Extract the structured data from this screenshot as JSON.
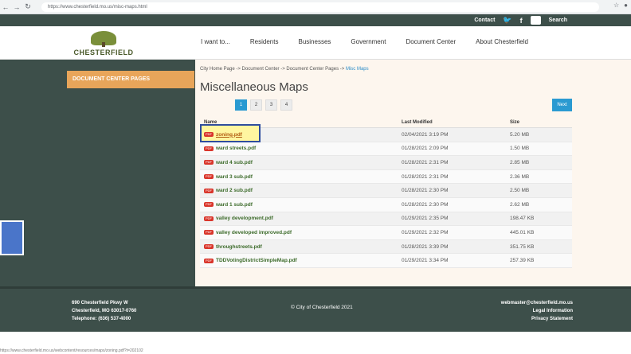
{
  "browser": {
    "url": "https://www.chesterfield.mo.us/misc-maps.html",
    "status_url": "https://www.chesterfield.mo.us/webcontent/resources/maps/zoning.pdf?t=202102"
  },
  "topbar": {
    "contact": "Contact",
    "search": "Search"
  },
  "logo": {
    "text": "CHESTERFIELD"
  },
  "nav": [
    "I want to...",
    "Residents",
    "Businesses",
    "Government",
    "Document Center",
    "About Chesterfield"
  ],
  "sidebar": {
    "title": "DOCUMENT CENTER PAGES"
  },
  "breadcrumb": {
    "items": [
      "City Home Page",
      "Document Center",
      "Document Center Pages"
    ],
    "sep": " -> ",
    "current": "Misc Maps"
  },
  "page_title": "Miscellaneous Maps",
  "pager": {
    "pages": [
      "1",
      "2",
      "3",
      "4"
    ],
    "next": "Next"
  },
  "table": {
    "headers": {
      "name": "Name",
      "modified": "Last Modified",
      "size": "Size"
    },
    "rows": [
      {
        "name": "zoning.pdf",
        "modified": "02/04/2021 3:19 PM",
        "size": "5.20 MB"
      },
      {
        "name": "ward streets.pdf",
        "modified": "01/28/2021 2:09 PM",
        "size": "1.50 MB"
      },
      {
        "name": "ward 4 sub.pdf",
        "modified": "01/28/2021 2:31 PM",
        "size": "2.85 MB"
      },
      {
        "name": "ward 3 sub.pdf",
        "modified": "01/28/2021 2:31 PM",
        "size": "2.36 MB"
      },
      {
        "name": "ward 2 sub.pdf",
        "modified": "01/28/2021 2:30 PM",
        "size": "2.50 MB"
      },
      {
        "name": "ward 1 sub.pdf",
        "modified": "01/28/2021 2:30 PM",
        "size": "2.62 MB"
      },
      {
        "name": "valley development.pdf",
        "modified": "01/29/2021 2:35 PM",
        "size": "198.47 KB"
      },
      {
        "name": "valley developed improved.pdf",
        "modified": "01/29/2021 2:32 PM",
        "size": "445.01 KB"
      },
      {
        "name": "throughstreets.pdf",
        "modified": "01/28/2021 3:39 PM",
        "size": "351.75 KB"
      },
      {
        "name": "TDDVotingDistrictSimpleMap.pdf",
        "modified": "01/29/2021 3:34 PM",
        "size": "257.39 KB"
      }
    ]
  },
  "footer": {
    "address1": "690 Chesterfield Pkwy W",
    "address2": "Chesterfield, MO 63017-0760",
    "phone": "Telephone: (636) 537-4000",
    "copyright": "© City of Chesterfield 2021",
    "email": "webmaster@chesterfield.mo.us",
    "legal": "Legal Information",
    "privacy": "Privacy Statement"
  }
}
